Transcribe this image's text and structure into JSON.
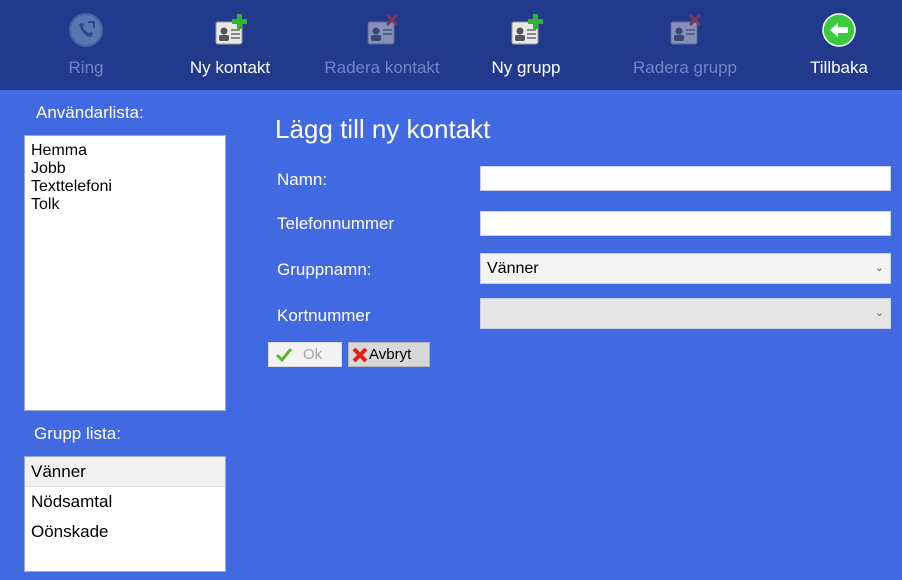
{
  "toolbar": {
    "ring": "Ring",
    "new_contact": "Ny kontakt",
    "delete_contact": "Radera kontakt",
    "new_group": "Ny grupp",
    "delete_group": "Radera grupp",
    "back": "Tillbaka"
  },
  "sidebar": {
    "user_list_title": "Användarlista:",
    "users": [
      "Hemma",
      "Jobb",
      "Texttelefoni",
      "Tolk"
    ],
    "group_list_title": "Grupp lista:",
    "groups": [
      "Vänner",
      "Nödsamtal",
      "Oönskade"
    ]
  },
  "form": {
    "title": "Lägg till ny kontakt",
    "name_label": "Namn:",
    "name_value": "",
    "phone_label": "Telefonnummer",
    "phone_value": "",
    "group_label": "Gruppnamn:",
    "group_value": "Vänner",
    "card_label": "Kortnummer",
    "card_value": "",
    "ok_label": "Ok",
    "cancel_label": "Avbryt"
  },
  "colors": {
    "background": "#4169e1",
    "toolbar": "#213a8c",
    "disabled_text": "#6f86c9"
  }
}
